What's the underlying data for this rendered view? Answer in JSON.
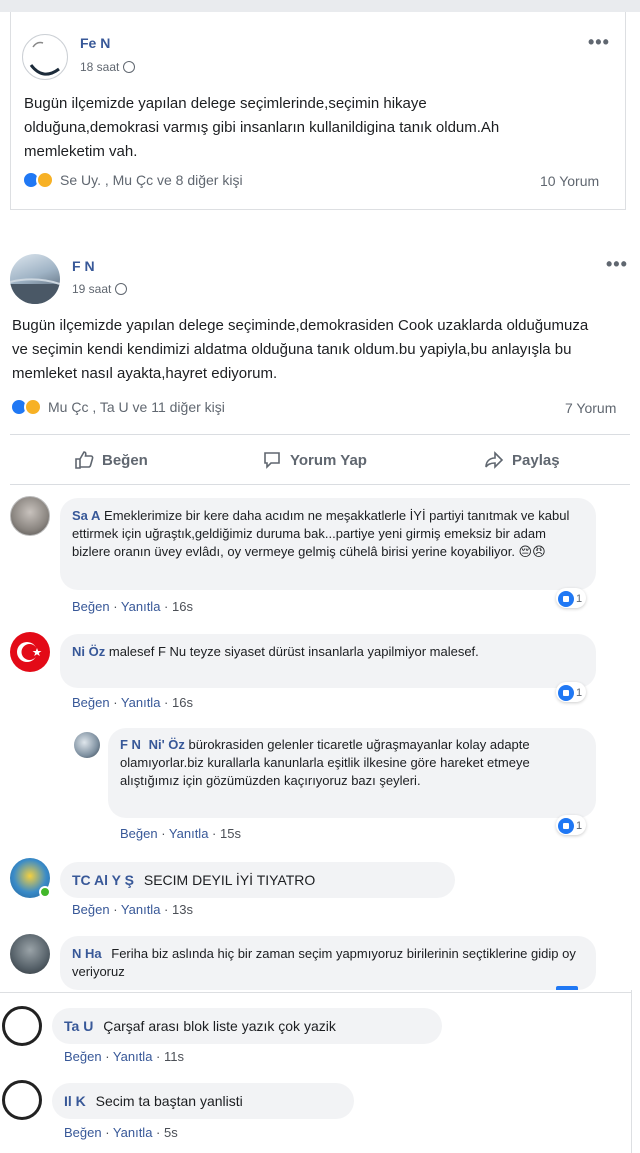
{
  "post1": {
    "author": "Fe      N",
    "time": "18 saat",
    "text": "Bugün ilçemizde yapılan delege seçimlerinde,seçimin hikaye olduğuna,demokrasi varmış gibi insanların kullanildigina tanık oldum.Ah memleketim vah.",
    "reactions": "Se        Uy.   , Mu         Çc        ve 8 diğer kişi",
    "comments": "10 Yorum"
  },
  "post2": {
    "author": "F       N",
    "time": "19 saat",
    "text": "Bugün ilçemizde yapılan delege seçiminde,demokrasiden Cook uzaklarda olduğumuza ve seçimin kendi kendimizi aldatma olduğuna tanık oldum.bu yapiyla,bu anlayışla bu memleket nasıl ayakta,hayret ediyorum.",
    "reactions": "Mu          Çc        , Ta          U       ve 11 diğer kişi",
    "comments": "7 Yorum",
    "like_btn": "Beğen",
    "comment_btn": "Yorum Yap",
    "share_btn": "Paylaş"
  },
  "comments": [
    {
      "name": "Sa      A",
      "text": "Emeklerimize bir kere daha acıdım ne meşakkatlerle İYİ partiyi tanıtmak ve kabul ettirmek için uğraştık,geldiğimiz duruma bak...partiye yeni girmiş emeksiz bir adam bizlere oranın üvey evlâdı, oy vermeye gelmiş cühelâ birisi yerine koyabiliyor. 😔😠",
      "like": "Beğen",
      "reply": "Yanıtla",
      "time": "16s",
      "likes": "1"
    },
    {
      "name": "Ni      Öz",
      "text": "malesef F          Nu         teyze siyaset dürüst insanlarla yapilmiyor malesef.",
      "like": "Beğen",
      "reply": "Yanıtla",
      "time": "16s",
      "likes": "1"
    },
    {
      "name": "F        N",
      "mention": "Ni'      Öz",
      "text": "bürokrasiden gelenler ticaretle uğraşmayanlar kolay adapte olamıyorlar.biz kurallarla kanunlarla eşitlik ilkesine göre hareket etmeye alıştığımız için gözümüzden kaçırıyoruz bazı şeyleri.",
      "like": "Beğen",
      "reply": "Yanıtla",
      "time": "15s",
      "likes": "1"
    },
    {
      "name": "TC Al        Y        Ş",
      "text": "SECIM DEYIL İYİ TIYATRO",
      "like": "Beğen",
      "reply": "Yanıtla",
      "time": "13s"
    },
    {
      "name": "N        Ha",
      "text": "Feriha biz aslında hiç bir zaman seçim yapmıyoruz birilerinin seçtiklerine gidip oy veriyoruz"
    },
    {
      "name": "Ta         U",
      "text": "Çarşaf arası blok liste yazık çok yazik",
      "like": "Beğen",
      "reply": "Yanıtla",
      "time": "11s"
    },
    {
      "name": "Il        K",
      "text": "Secim ta baştan yanlisti",
      "like": "Beğen",
      "reply": "Yanıtla",
      "time": "5s"
    }
  ],
  "colors": {
    "link": "#385898",
    "like": "#2078f4",
    "bubble": "#f2f3f5",
    "turkish_red": "#e30a17"
  }
}
